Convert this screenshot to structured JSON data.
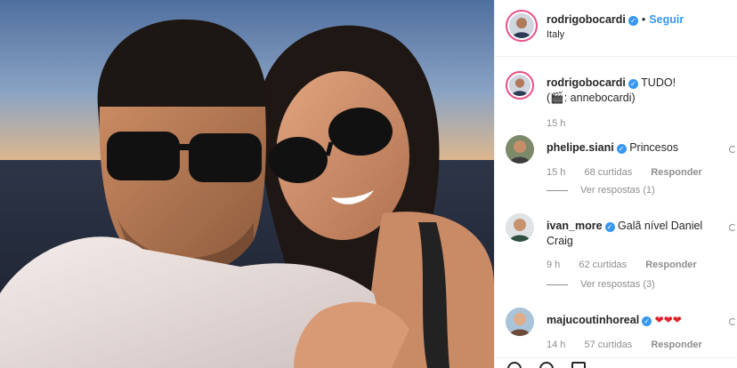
{
  "post": {
    "username": "rodrigobocardi",
    "location": "Italy",
    "follow_label": "Seguir",
    "separator": "•"
  },
  "caption": {
    "username": "rodrigobocardi",
    "text_line1": "TUDO!",
    "text_line2": "(🎬: annebocardi)",
    "time": "15 h"
  },
  "comments": [
    {
      "username": "phelipe.siani",
      "text": "Princesos",
      "time": "15 h",
      "likes": "68 curtidas",
      "reply_label": "Responder",
      "see_replies": "Ver respostas (1)"
    },
    {
      "username": "ivan_more",
      "text": "Galã nível Daniel Craig",
      "time": "9 h",
      "likes": "62 curtidas",
      "reply_label": "Responder",
      "see_replies": "Ver respostas (3)"
    },
    {
      "username": "majucoutinhoreal",
      "text": "❤❤❤",
      "time": "14 h",
      "likes": "57 curtidas",
      "reply_label": "Responder"
    }
  ],
  "icons": {
    "verified": "verified-badge-icon",
    "like": "heart-icon",
    "comment": "comment-icon",
    "share": "share-icon"
  },
  "colors": {
    "link_blue": "#3897f0",
    "verified_blue": "#3897f0",
    "heart_red": "#e0212b",
    "muted_text": "#8e8e8e"
  }
}
